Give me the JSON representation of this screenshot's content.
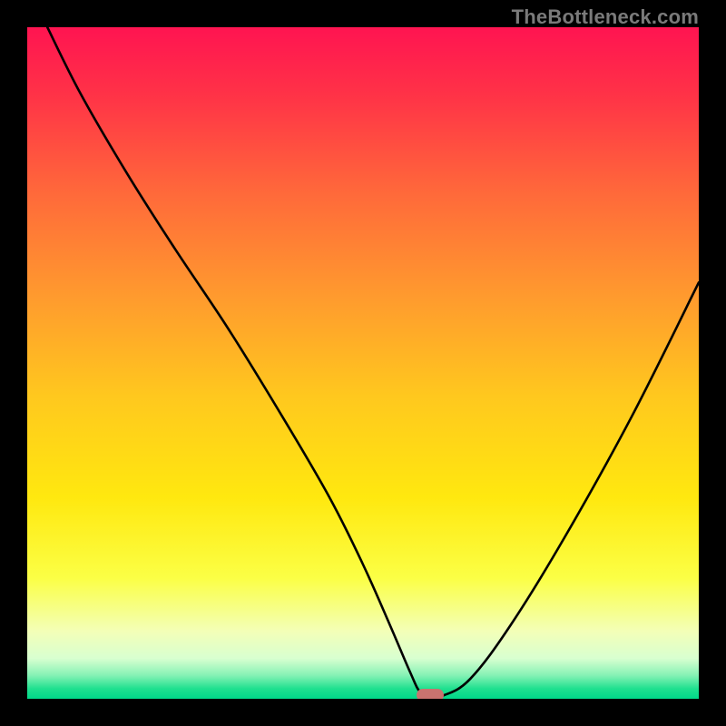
{
  "watermark": {
    "text": "TheBottleneck.com"
  },
  "chart_data": {
    "type": "line",
    "title": "",
    "xlabel": "",
    "ylabel": "",
    "xlim": [
      0,
      100
    ],
    "ylim": [
      0,
      100
    ],
    "grid": false,
    "legend": false,
    "series": [
      {
        "name": "bottleneck-curve",
        "x": [
          3,
          8,
          15,
          22,
          30,
          38,
          45,
          50,
          54,
          57,
          58.5,
          60,
          62,
          66,
          72,
          80,
          90,
          100
        ],
        "y": [
          100,
          90,
          78,
          67,
          55,
          42,
          30,
          20,
          11,
          4,
          1,
          0.5,
          0.5,
          3,
          11,
          24,
          42,
          62
        ]
      }
    ],
    "marker": {
      "x": 60,
      "y": 0.5,
      "color": "#c9736f"
    },
    "gradient_stops": [
      {
        "offset": 0,
        "color": "#ff1451"
      },
      {
        "offset": 0.1,
        "color": "#ff3247"
      },
      {
        "offset": 0.25,
        "color": "#ff6a3a"
      },
      {
        "offset": 0.4,
        "color": "#ff9a2e"
      },
      {
        "offset": 0.55,
        "color": "#ffc81e"
      },
      {
        "offset": 0.7,
        "color": "#ffe80f"
      },
      {
        "offset": 0.82,
        "color": "#fbff45"
      },
      {
        "offset": 0.9,
        "color": "#f3ffb8"
      },
      {
        "offset": 0.94,
        "color": "#d8ffd0"
      },
      {
        "offset": 0.965,
        "color": "#86f2b5"
      },
      {
        "offset": 0.985,
        "color": "#1fe08f"
      },
      {
        "offset": 1.0,
        "color": "#00d889"
      }
    ]
  }
}
